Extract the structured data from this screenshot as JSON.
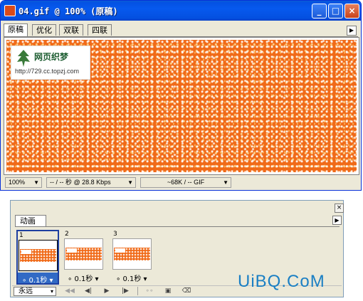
{
  "window": {
    "title": "04.gif @ 100% (原稿)",
    "buttons": {
      "minimize": "_",
      "maximize": "□",
      "close": "×"
    }
  },
  "tabs": [
    {
      "label": "原稿",
      "active": true
    },
    {
      "label": "优化",
      "active": false
    },
    {
      "label": "双联",
      "active": false
    },
    {
      "label": "四联",
      "active": false
    }
  ],
  "canvas": {
    "pattern_color": "#f06a18",
    "logo": {
      "title": "网页织梦",
      "url": "http://729.cc.topzj.com"
    }
  },
  "statusbar": {
    "zoom": "100%",
    "download_time": "-- / -- 秒 @ 28.8 Kbps",
    "file_info": "~68K / -- GIF"
  },
  "animation_panel": {
    "tab_label": "动画",
    "frames": [
      {
        "number": "1",
        "delay": "0.1秒",
        "selected": true
      },
      {
        "number": "2",
        "delay": "0.1秒",
        "selected": false
      },
      {
        "number": "3",
        "delay": "0.1秒",
        "selected": false
      }
    ],
    "loop_option": "永远",
    "accent_color": "#316ac5"
  },
  "watermark": "UiBQ.CoM"
}
